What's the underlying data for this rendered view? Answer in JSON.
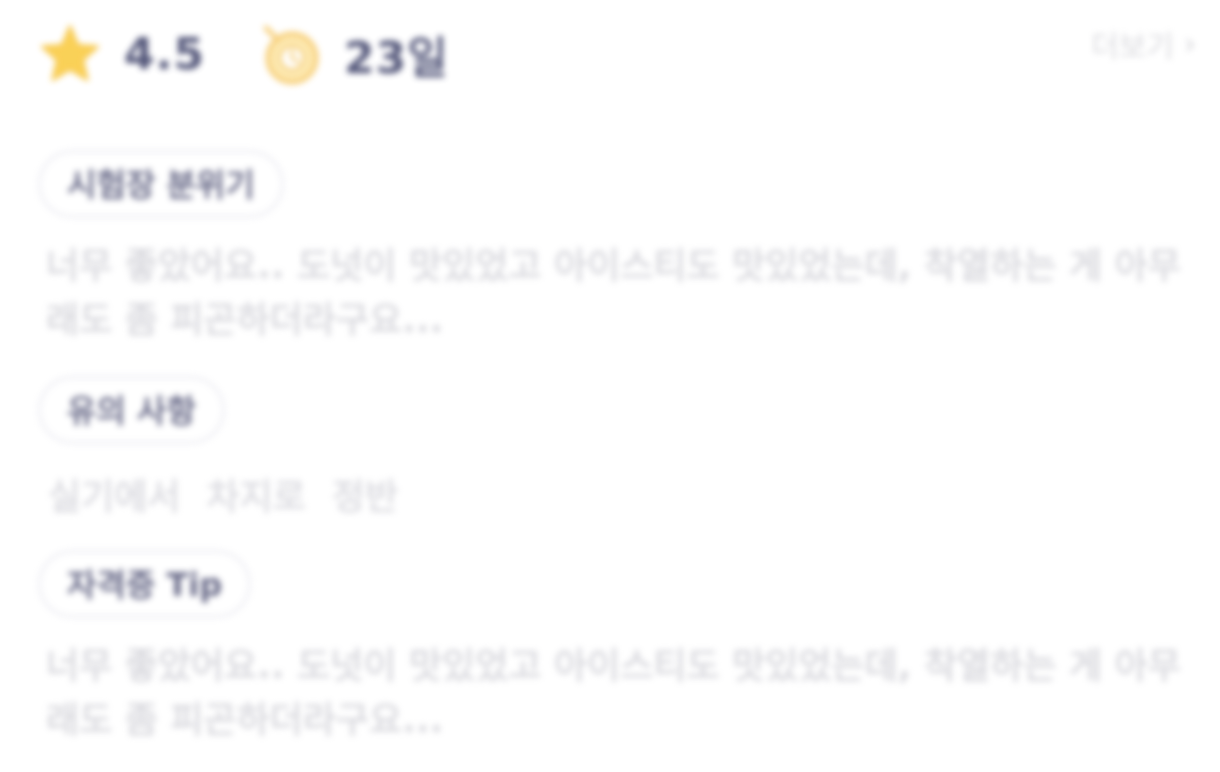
{
  "stats": {
    "rating": "4.5",
    "period": "23일",
    "rating_icon": "star-icon",
    "period_icon": "clock-icon",
    "star_color": "#f9c93a",
    "clock_color": "#f6c866"
  },
  "more_link": {
    "label": "더보기",
    "chevron": "›"
  },
  "sections": [
    {
      "pill_label": "시험장 분위기",
      "text": "너무 좋았어요.. 도넛이 맛있었고 아이스티도 맛있었는데, 착열하는 게 아무래도 좀 피곤하더라구요..."
    },
    {
      "pill_label": "유의 사항",
      "tags": [
        "실기에서",
        "차지로",
        "정반"
      ]
    },
    {
      "pill_label": "자격증 Tip",
      "text": "너무 좋았어요.. 도넛이 맛있었고 아이스티도 맛있었는데, 착열하는 게 아무래도 좀 피곤하더라구요..."
    }
  ]
}
